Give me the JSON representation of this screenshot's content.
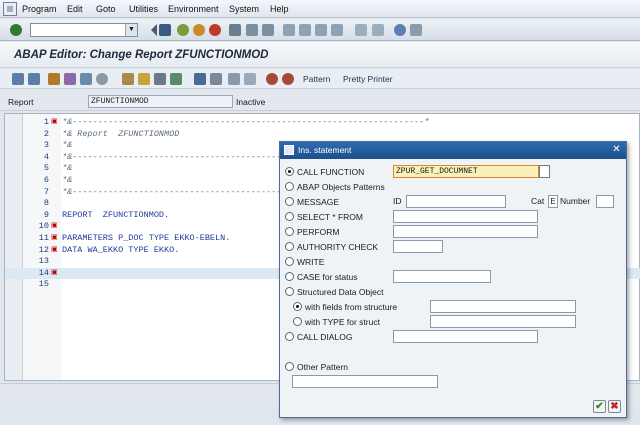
{
  "menubar": {
    "items": [
      "Program",
      "Edit",
      "Goto",
      "Utilities",
      "Environment",
      "System",
      "Help"
    ]
  },
  "titlebar": {
    "title": "ABAP Editor: Change Report ZFUNCTIONMOD"
  },
  "app_toolbar": {
    "pattern_label": "Pattern",
    "pretty_printer_label": "Pretty Printer"
  },
  "report_line": {
    "label": "Report",
    "value": "ZFUNCTIONMOD",
    "status": "Inactive"
  },
  "editor": {
    "lines": [
      {
        "num": "1",
        "mark": "▣",
        "text": "*&---------------------------------------------------------------------*",
        "kind": "comment"
      },
      {
        "num": "2",
        "mark": "",
        "text": "*& Report  ZFUNCTIONMOD",
        "kind": "comment"
      },
      {
        "num": "3",
        "mark": "",
        "text": "*&",
        "kind": "comment"
      },
      {
        "num": "4",
        "mark": "",
        "text": "*&---------------------------------------------------------------------*",
        "kind": "comment"
      },
      {
        "num": "5",
        "mark": "",
        "text": "*&",
        "kind": "comment"
      },
      {
        "num": "6",
        "mark": "",
        "text": "*&",
        "kind": "comment"
      },
      {
        "num": "7",
        "mark": "",
        "text": "*&---------------------------------------------------------------------*",
        "kind": "comment"
      },
      {
        "num": "8",
        "mark": "",
        "text": "",
        "kind": "code"
      },
      {
        "num": "9",
        "mark": "",
        "text": "REPORT  ZFUNCTIONMOD.",
        "kind": "code"
      },
      {
        "num": "10",
        "mark": "▣",
        "text": "",
        "kind": "code"
      },
      {
        "num": "11",
        "mark": "▣",
        "text": "PARAMETERS P_DOC TYPE EKKO-EBELN.",
        "kind": "code"
      },
      {
        "num": "12",
        "mark": "▣",
        "text": "DATA WA_EKKO TYPE EKKO.",
        "kind": "code"
      },
      {
        "num": "13",
        "mark": "",
        "text": "",
        "kind": "code"
      },
      {
        "num": "14",
        "mark": "▣",
        "text": "",
        "kind": "current"
      },
      {
        "num": "15",
        "mark": "",
        "text": "",
        "kind": "code"
      }
    ]
  },
  "dialog": {
    "title": "Ins. statement",
    "call_function": {
      "label": "CALL FUNCTION",
      "value": "ZPUR_GET_DOCUMNET"
    },
    "abap_objects": {
      "label": "ABAP Objects Patterns"
    },
    "message": {
      "label": "MESSAGE",
      "id_label": "ID",
      "cat_label": "Cat",
      "cat_value": "E",
      "number_label": "Number"
    },
    "select": {
      "label": "SELECT * FROM"
    },
    "perform": {
      "label": "PERFORM"
    },
    "authority": {
      "label": "AUTHORITY CHECK"
    },
    "write": {
      "label": "WRITE"
    },
    "case": {
      "label": "CASE for status"
    },
    "structured": {
      "label": "Structured Data Object"
    },
    "with_fields": {
      "label": "with fields from structure"
    },
    "with_type": {
      "label": "with TYPE for struct"
    },
    "call_dialog": {
      "label": "CALL DIALOG"
    },
    "other": {
      "label": "Other Pattern"
    },
    "ok_icon": "green-check-icon",
    "cancel_icon": "red-cross-icon",
    "ok_color": "#2e8b1f",
    "cancel_color": "#c0261a"
  }
}
